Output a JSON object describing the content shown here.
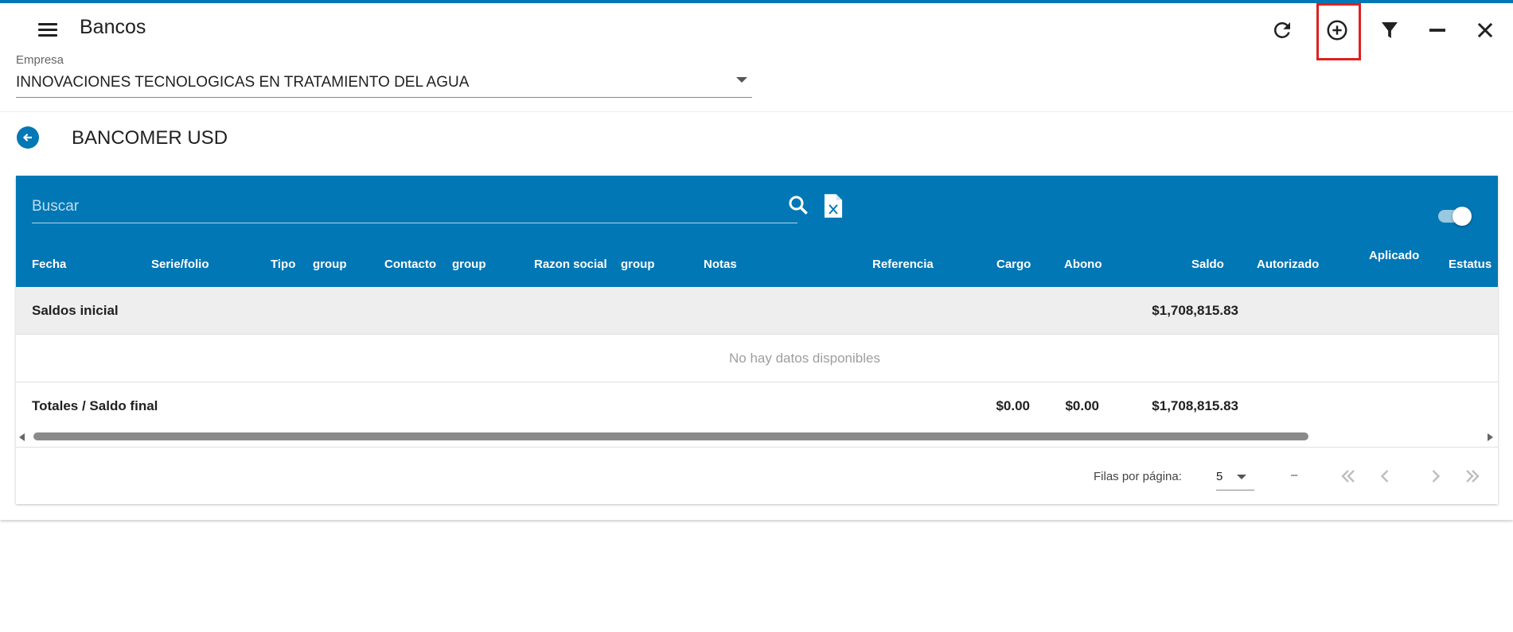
{
  "app": {
    "title": "Bancos"
  },
  "toolbar": {
    "icons": [
      "refresh-icon",
      "add-circle-icon",
      "filter-icon",
      "minimize-icon",
      "close-icon"
    ]
  },
  "empresa": {
    "label": "Empresa",
    "value": "INNOVACIONES TECNOLOGICAS EN TRATAMIENTO DEL AGUA"
  },
  "bank": {
    "title": "BANCOMER USD"
  },
  "table": {
    "search_placeholder": "Buscar",
    "columns": [
      "Fecha",
      "Serie/folio",
      "Tipo",
      "group",
      "Contacto",
      "group",
      "Razon social",
      "group",
      "Notas",
      "Referencia",
      "Cargo",
      "Abono",
      "Saldo",
      "Autorizado",
      "Aplicado",
      "Estatus"
    ],
    "initial": {
      "label": "Saldos inicial",
      "saldo": "$1,708,815.83"
    },
    "empty_message": "No hay datos disponibles",
    "totals": {
      "label": "Totales / Saldo final",
      "cargo": "$0.00",
      "abono": "$0.00",
      "saldo": "$1,708,815.83"
    }
  },
  "pagination": {
    "rows_label": "Filas por página:",
    "rows_value": "5",
    "range": "–"
  },
  "colors": {
    "primary": "#0277b5",
    "highlight": "#e02020",
    "row_alt": "#eeeeee"
  }
}
